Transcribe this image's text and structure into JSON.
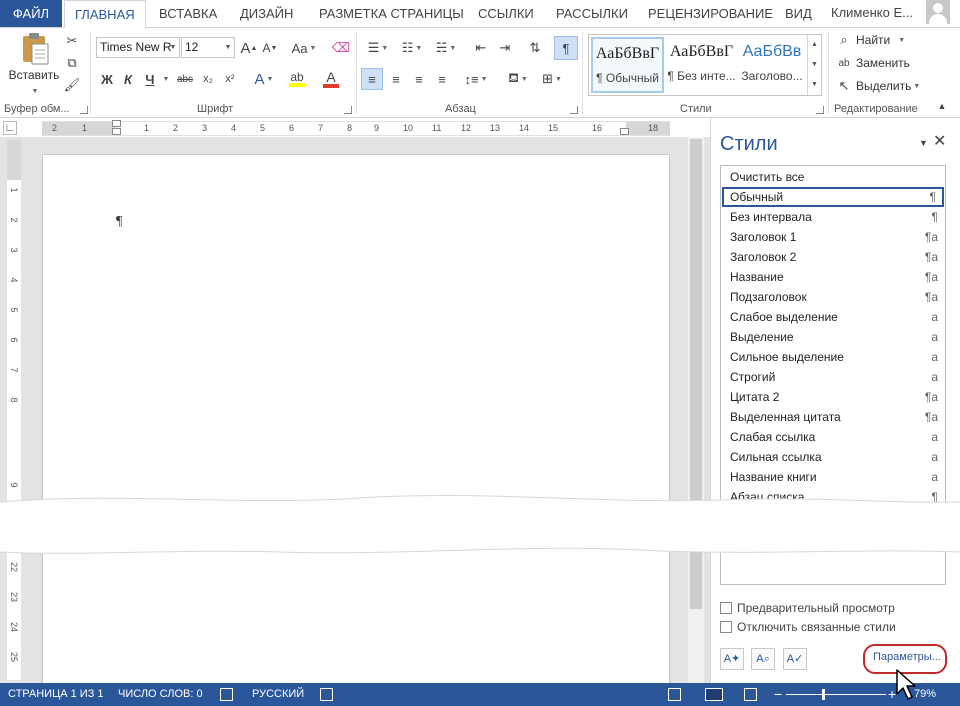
{
  "tabs": {
    "file": "ФАЙЛ",
    "home": "ГЛАВНАЯ",
    "insert": "ВСТАВКА",
    "design": "ДИЗАЙН",
    "layout": "РАЗМЕТКА СТРАНИЦЫ",
    "references": "ССЫЛКИ",
    "mailings": "РАССЫЛКИ",
    "review": "РЕЦЕНЗИРОВАНИЕ",
    "view": "ВИД",
    "user": "Клименко Е..."
  },
  "ribbon": {
    "clipboard": {
      "paste_label": "Вставить",
      "group_label": "Буфер обм..."
    },
    "font": {
      "font_name": "Times New R",
      "font_size": "12",
      "group_label": "Шрифт",
      "bold": "Ж",
      "italic": "К",
      "underline": "Ч",
      "strike": "abc",
      "subscript": "x₂",
      "superscript": "x²",
      "grow": "A",
      "shrink": "A",
      "case": "Aa",
      "effects": "A",
      "color": "A"
    },
    "paragraph": {
      "group_label": "Абзац"
    },
    "styles": {
      "group_label": "Стили",
      "items": [
        {
          "preview": "АаБбВвГ",
          "name": "¶ Обычный"
        },
        {
          "preview": "АаБбВвГ",
          "name": "¶ Без инте..."
        },
        {
          "preview": "АаБбВв",
          "name": "Заголово..."
        }
      ]
    },
    "editing": {
      "group_label": "Редактирование",
      "find": "Найти",
      "replace": "Заменить",
      "select": "Выделить"
    }
  },
  "ruler": {
    "numbers": [
      "2",
      "1",
      "1",
      "2",
      "3",
      "4",
      "5",
      "6",
      "7",
      "8",
      "9",
      "10",
      "11",
      "12",
      "13",
      "14",
      "15",
      "16",
      "18"
    ],
    "vertical_numbers": [
      "1",
      "2",
      "3",
      "4",
      "5",
      "6",
      "7",
      "8",
      "9",
      "22",
      "23",
      "24",
      "25"
    ]
  },
  "document": {
    "paragraph_mark": "¶"
  },
  "styles_pane": {
    "title": "Стили",
    "items": [
      {
        "name": "Очистить все",
        "marker": ""
      },
      {
        "name": "Обычный",
        "marker": "¶"
      },
      {
        "name": "Без интервала",
        "marker": "¶"
      },
      {
        "name": "Заголовок 1",
        "marker": "¶a"
      },
      {
        "name": "Заголовок 2",
        "marker": "¶a"
      },
      {
        "name": "Название",
        "marker": "¶a"
      },
      {
        "name": "Подзаголовок",
        "marker": "¶a"
      },
      {
        "name": "Слабое выделение",
        "marker": "a"
      },
      {
        "name": "Выделение",
        "marker": "a"
      },
      {
        "name": "Сильное выделение",
        "marker": "a"
      },
      {
        "name": "Строгий",
        "marker": "a"
      },
      {
        "name": "Цитата 2",
        "marker": "¶a"
      },
      {
        "name": "Выделенная цитата",
        "marker": "¶a"
      },
      {
        "name": "Слабая ссылка",
        "marker": "a"
      },
      {
        "name": "Сильная ссылка",
        "marker": "a"
      },
      {
        "name": "Название книги",
        "marker": "a"
      },
      {
        "name": "Абзац списка",
        "marker": "¶"
      }
    ],
    "selected_index": 1,
    "preview_label": "Предварительный просмотр",
    "disable_linked_label": "Отключить связанные стили",
    "options_label": "Параметры..."
  },
  "status": {
    "page": "СТРАНИЦА 1 ИЗ 1",
    "words": "ЧИСЛО СЛОВ: 0",
    "language": "РУССКИЙ",
    "zoom_plus": "+",
    "zoom": "79%"
  },
  "colors": {
    "accent": "#2b579a",
    "highlight": "#cde0f5",
    "callout": "#c0282d",
    "font_color": "#e03a2f",
    "highlighter": "#ffff00"
  }
}
